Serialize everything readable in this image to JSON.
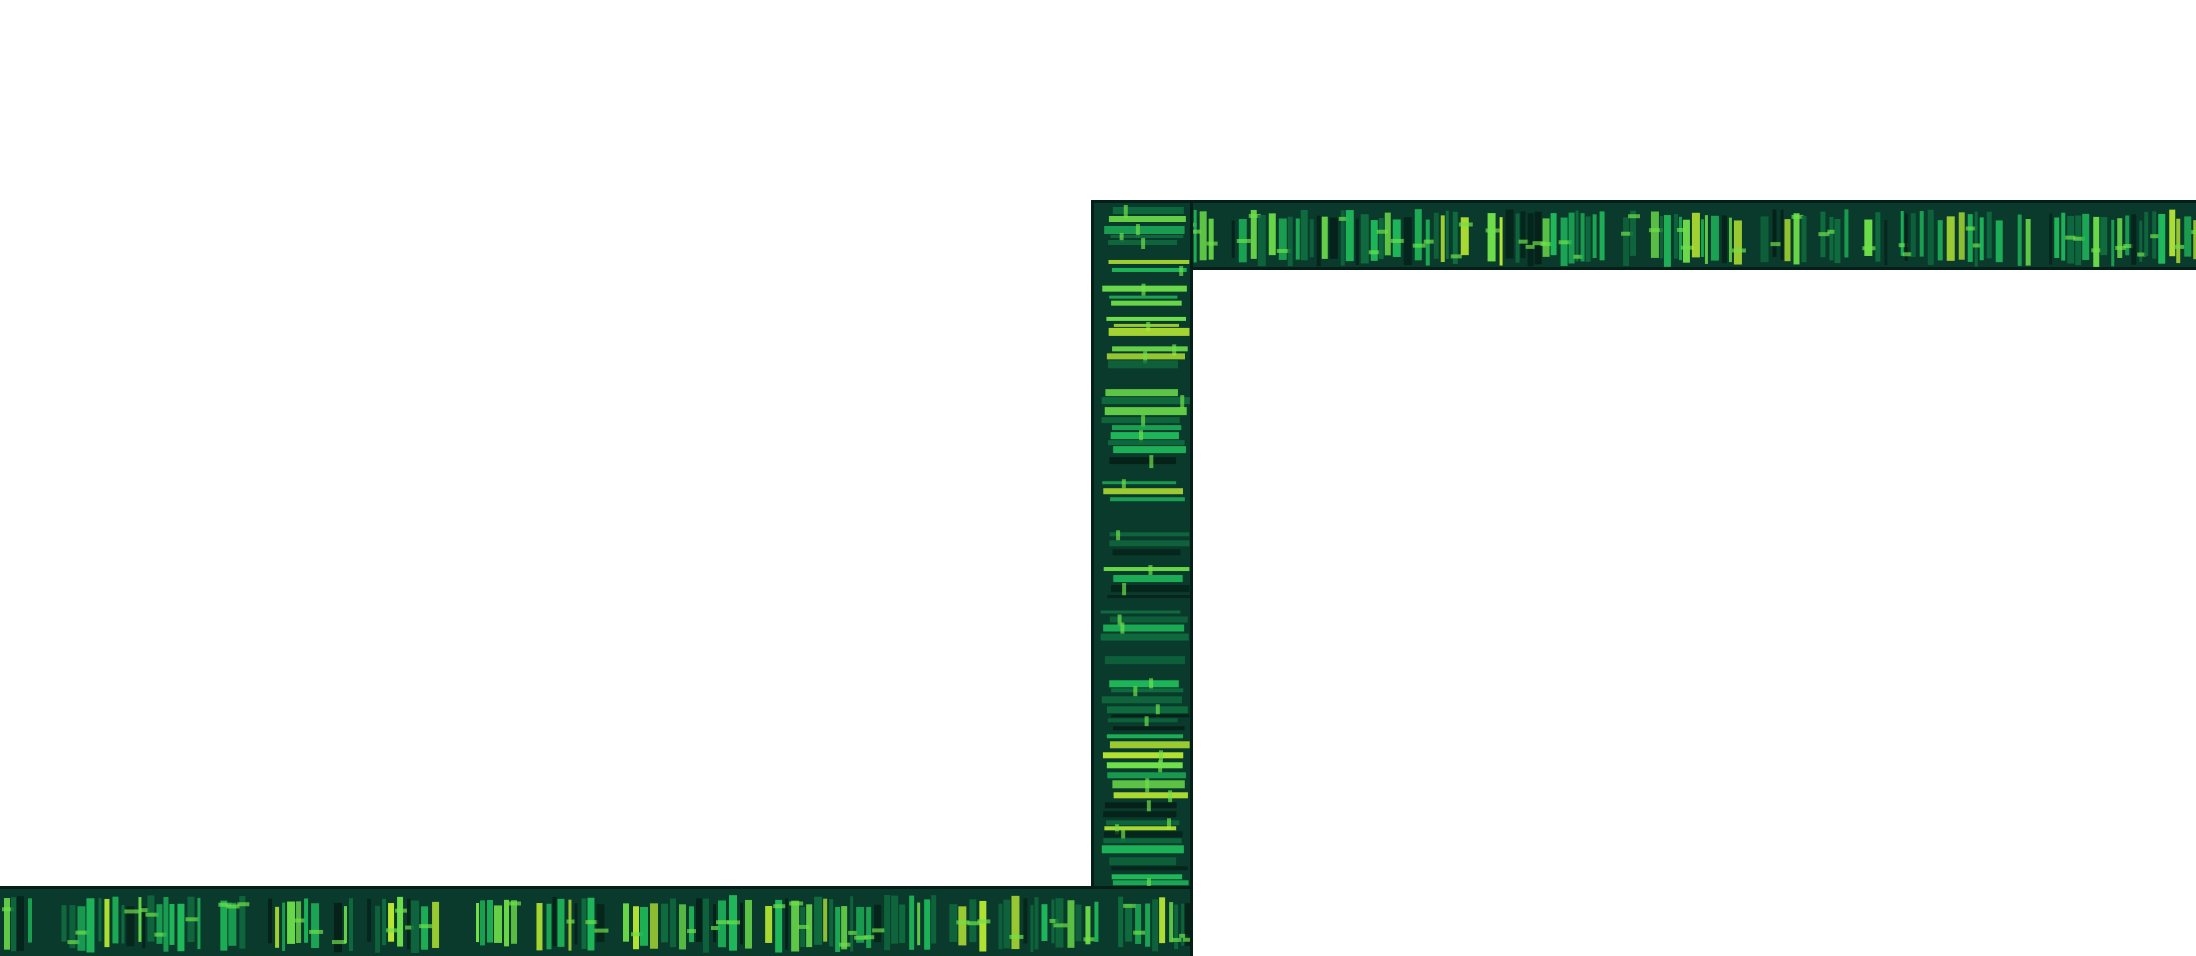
{
  "page": {
    "background": "#ffffff"
  },
  "bands": {
    "style": "green-glyph-texture",
    "colors": {
      "border": "#061e18",
      "base": "#0a3a2c",
      "dark": "#052118",
      "mid": "#0f6b3e",
      "bright": "#1fb85a",
      "highlight": "#6fe04a",
      "accent": "#b8e832"
    }
  }
}
